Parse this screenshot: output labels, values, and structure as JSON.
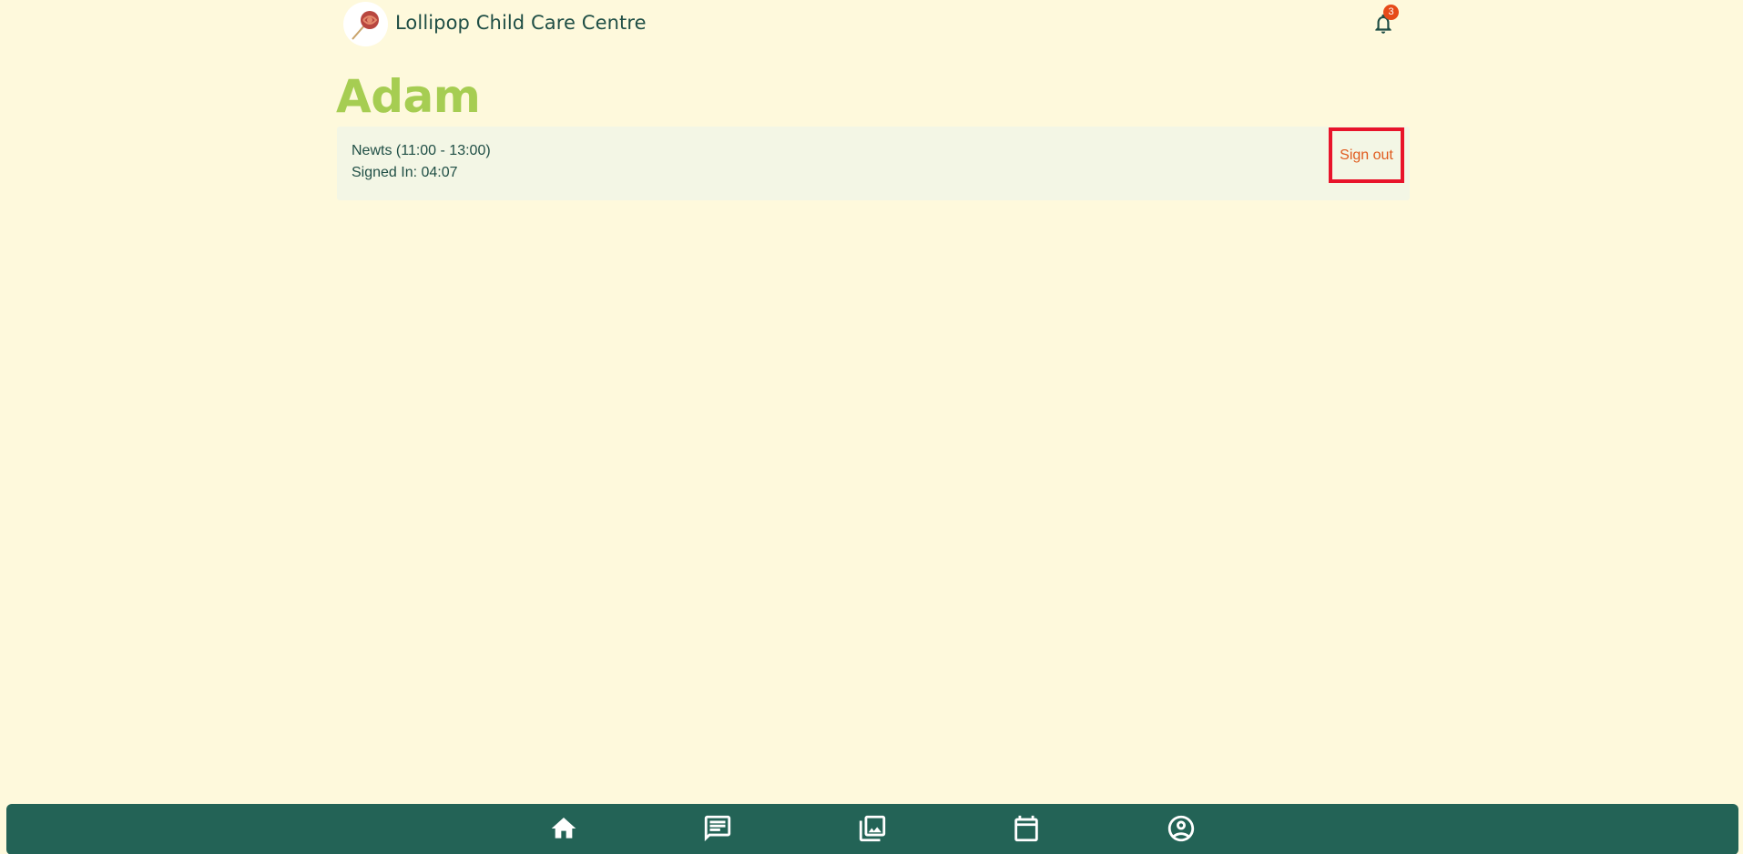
{
  "header": {
    "app_title": "Lollipop Child Care Centre",
    "notification_count": "3",
    "logo_icon": "lollipop-logo",
    "bell_icon": "bell-icon"
  },
  "child": {
    "name": "Adam"
  },
  "session": {
    "room": "Newts (11:00 - 13:00)",
    "signed_in": "Signed In: 04:07",
    "sign_out_label": "Sign out"
  },
  "bottom_nav": {
    "items": [
      {
        "icon": "home-icon",
        "label": ""
      },
      {
        "icon": "chat-icon",
        "label": ""
      },
      {
        "icon": "gallery-icon",
        "label": ""
      },
      {
        "icon": "calendar-icon",
        "label": ""
      },
      {
        "icon": "account-icon",
        "label": ""
      }
    ]
  },
  "colors": {
    "background": "#fef9dc",
    "primary": "#236356",
    "accent_name": "#a6cd52",
    "sign_out_text": "#e05b1e",
    "badge": "#e64a19"
  }
}
